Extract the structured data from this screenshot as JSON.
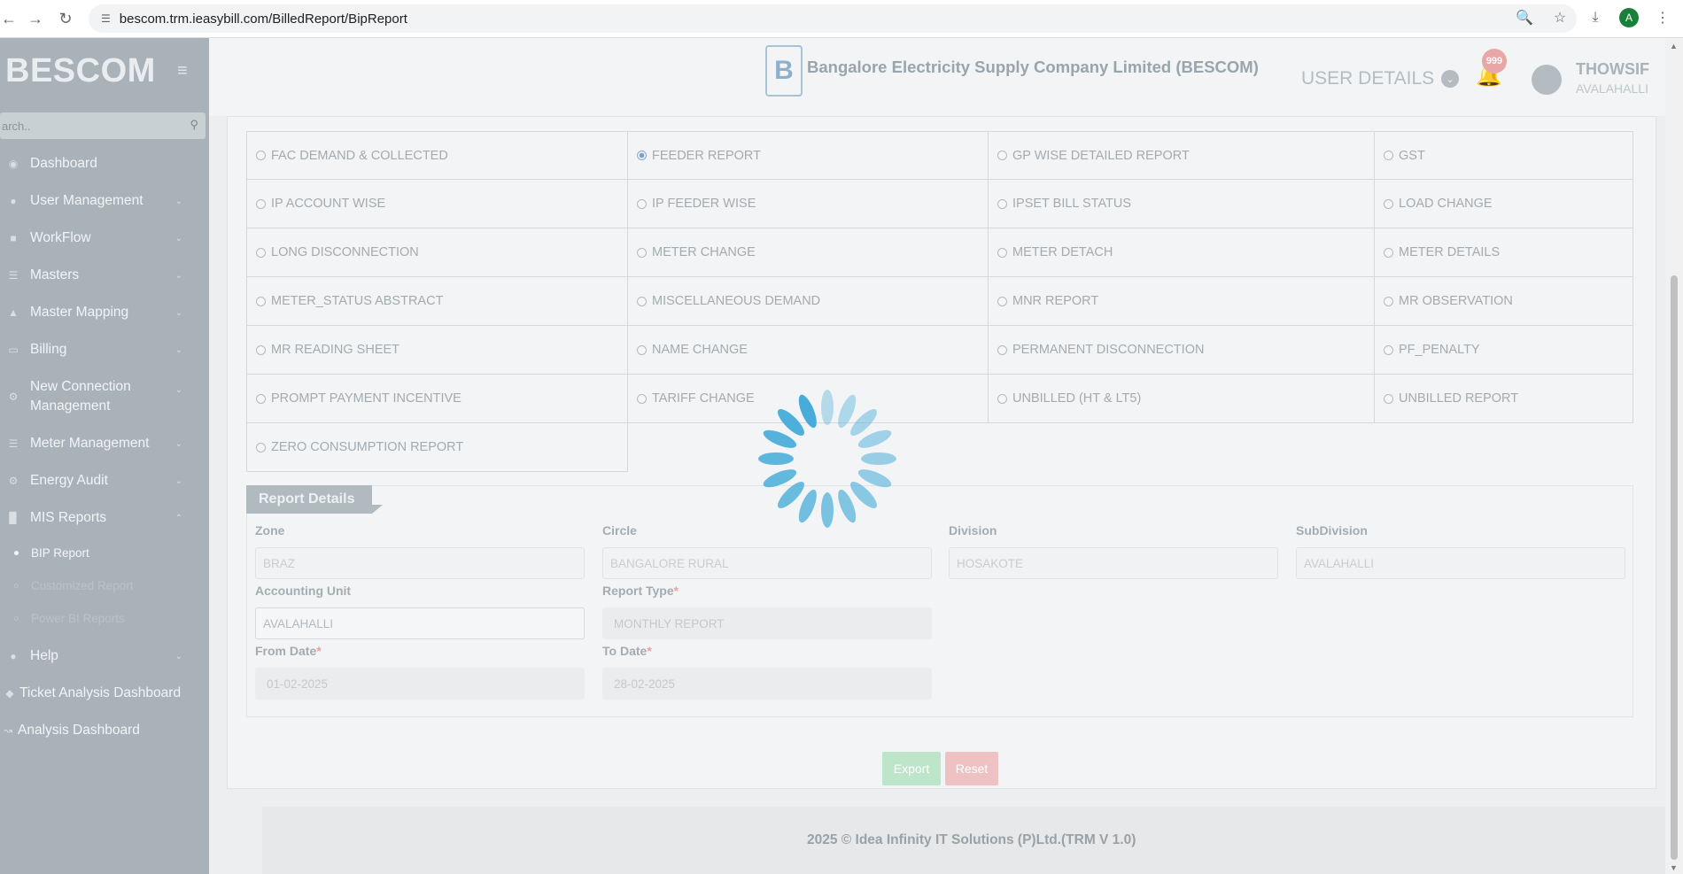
{
  "browser": {
    "url": "bescom.trm.ieasybill.com/BilledReport/BipReport"
  },
  "sidebar": {
    "brand": "BESCOM",
    "search_placeholder": "arch..",
    "items": [
      {
        "label": "Dashboard",
        "icon": "dashboard-icon"
      },
      {
        "label": "User Management",
        "icon": "user-icon"
      },
      {
        "label": "WorkFlow",
        "icon": "workflow-icon"
      },
      {
        "label": "Masters",
        "icon": "list-icon"
      },
      {
        "label": "Master Mapping",
        "icon": "sitemap-icon"
      },
      {
        "label": "Billing",
        "icon": "monitor-icon"
      },
      {
        "label": "New Connection Management",
        "icon": "gear-icon"
      },
      {
        "label": "Meter Management",
        "icon": "list-icon"
      },
      {
        "label": "Energy Audit",
        "icon": "cogs-icon"
      },
      {
        "label": "MIS Reports",
        "icon": "bar-chart-icon"
      }
    ],
    "submenu": [
      {
        "label": "BIP Report"
      },
      {
        "label": "Customized Report"
      },
      {
        "label": "Power BI Reports"
      }
    ],
    "bottom_items": [
      {
        "label": "Help",
        "icon": "help-icon"
      },
      {
        "label": "Ticket Analysis Dashboard",
        "icon": "ticket-icon"
      },
      {
        "label": "Analysis Dashboard",
        "icon": "line-chart-icon"
      }
    ]
  },
  "header": {
    "company": "Bangalore Electricity Supply Company Limited (BESCOM)",
    "user_details": "USER DETAILS",
    "notification_count": "999",
    "user_name": "THOWSIF",
    "user_location": "AVALAHALLI"
  },
  "reports": {
    "selected": "FEEDER REPORT",
    "rows": [
      [
        "FAC DEMAND & COLLECTED",
        "FEEDER REPORT",
        "GP WISE DETAILED REPORT",
        "GST"
      ],
      [
        "IP ACCOUNT WISE",
        "IP FEEDER WISE",
        "IPSET BILL STATUS",
        "LOAD CHANGE"
      ],
      [
        "LONG DISCONNECTION",
        "METER CHANGE",
        "METER DETACH",
        "METER DETAILS"
      ],
      [
        "METER_STATUS ABSTRACT",
        "MISCELLANEOUS DEMAND",
        "MNR REPORT",
        "MR OBSERVATION"
      ],
      [
        "MR READING SHEET",
        "NAME CHANGE",
        "PERMANENT DISCONNECTION",
        "PF_PENALTY"
      ],
      [
        "PROMPT PAYMENT INCENTIVE",
        "TARIFF CHANGE",
        "UNBILLED (HT & LT5)",
        "UNBILLED REPORT"
      ],
      [
        "ZERO CONSUMPTION REPORT"
      ]
    ]
  },
  "report_details": {
    "title": "Report Details",
    "zone_label": "Zone",
    "zone_value": "BRAZ",
    "circle_label": "Circle",
    "circle_value": "BANGALORE RURAL",
    "division_label": "Division",
    "division_value": "HOSAKOTE",
    "subdivision_label": "SubDivision",
    "subdivision_value": "AVALAHALLI",
    "accounting_unit_label": "Accounting Unit",
    "accounting_unit_value": "AVALAHALLI",
    "report_type_label": "Report Type",
    "report_type_value": "MONTHLY REPORT",
    "from_date_label": "From Date",
    "from_date_value": "01-02-2025",
    "to_date_label": "To Date",
    "to_date_value": "28-02-2025",
    "required_mark": "*"
  },
  "actions": {
    "export": "Export",
    "reset": "Reset"
  },
  "footer": {
    "text": "2025 © Idea Infinity IT Solutions (P)Ltd.(TRM V 1.0)"
  },
  "colors": {
    "spinner": "#3fa9d8",
    "sidebar": "#a8b2b8"
  }
}
